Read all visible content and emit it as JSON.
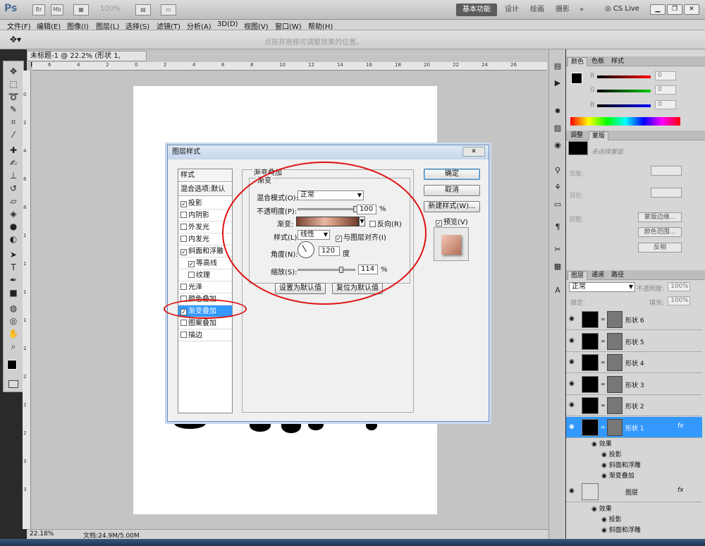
{
  "app": {
    "logo": "Ps",
    "zoom": "100%",
    "workspaces": [
      "基本功能",
      "设计",
      "绘画",
      "摄影"
    ],
    "more": "»",
    "cslive": "CS Live"
  },
  "menu": [
    "文件(F)",
    "编辑(E)",
    "图像(I)",
    "图层(L)",
    "选择(S)",
    "滤镜(T)",
    "分析(A)",
    "3D(D)",
    "视图(V)",
    "窗口(W)",
    "帮助(H)"
  ],
  "options_hint": "点按并拖移可调整效果的位置。",
  "doc": {
    "tab": "未标题-1 @ 22.2% (形状 1, RGB/8) *",
    "ruler_top": [
      "6",
      "4",
      "2",
      "0",
      "2",
      "4",
      "6",
      "8",
      "10",
      "12",
      "14",
      "16",
      "18",
      "20",
      "22",
      "24",
      "26"
    ],
    "ruler_left": [
      "0",
      "2",
      "4",
      "6",
      "8",
      "1",
      "1",
      "1",
      "1",
      "2",
      "2",
      "2",
      "2",
      "3",
      "3"
    ],
    "status_zoom": "22.18%",
    "status_doc": "文档:24.9M/5.00M"
  },
  "dialog": {
    "title": "图层样式",
    "close": "✕",
    "styles_header": "样式",
    "blend_default": "混合选项:默认",
    "items": [
      {
        "label": "投影",
        "checked": true,
        "sub": false,
        "selected": false
      },
      {
        "label": "内阴影",
        "checked": false,
        "sub": false,
        "selected": false
      },
      {
        "label": "外发光",
        "checked": false,
        "sub": false,
        "selected": false
      },
      {
        "label": "内发光",
        "checked": false,
        "sub": false,
        "selected": false
      },
      {
        "label": "斜面和浮雕",
        "checked": true,
        "sub": false,
        "selected": false
      },
      {
        "label": "等高线",
        "checked": true,
        "sub": true,
        "selected": false
      },
      {
        "label": "纹理",
        "checked": false,
        "sub": true,
        "selected": false
      },
      {
        "label": "光泽",
        "checked": false,
        "sub": false,
        "selected": false
      },
      {
        "label": "颜色叠加",
        "checked": false,
        "sub": false,
        "selected": false
      },
      {
        "label": "渐变叠加",
        "checked": true,
        "sub": false,
        "selected": true
      },
      {
        "label": "图案叠加",
        "checked": false,
        "sub": false,
        "selected": false
      },
      {
        "label": "描边",
        "checked": false,
        "sub": false,
        "selected": false
      }
    ],
    "section_title": "渐变叠加",
    "group_title": "渐变",
    "blend_mode_label": "混合模式(O):",
    "blend_mode_value": "正常",
    "opacity_label": "不透明度(P):",
    "opacity_value": "100",
    "opacity_unit": "%",
    "opacity_fraction": 1.0,
    "gradient_label": "渐变:",
    "reverse_label": "反向(R)",
    "style_label": "样式(L):",
    "style_value": "线性",
    "align_label": "与图层对齐(I)",
    "angle_label": "角度(N):",
    "angle_value": "120",
    "angle_unit": "度",
    "scale_label": "缩放(S):",
    "scale_value": "114",
    "scale_unit": "%",
    "scale_fraction": 0.76,
    "btn_set_default": "设置为默认值",
    "btn_reset_default": "复位为默认值",
    "btn_ok": "确定",
    "btn_cancel": "取消",
    "btn_new_style": "新建样式(W)...",
    "preview_label": "预览(V)",
    "preview_checked": true
  },
  "color_panel": {
    "tabs": [
      "颜色",
      "色板",
      "样式"
    ],
    "channels": [
      {
        "label": "R",
        "value": "0"
      },
      {
        "label": "G",
        "value": "0"
      },
      {
        "label": "B",
        "value": "0"
      }
    ]
  },
  "adjust_panel": {
    "tabs": [
      "调整",
      "蒙版"
    ],
    "no_mask": "未选择蒙版",
    "density_label": "浓度:",
    "feather_label": "羽化:",
    "refine_label": "调整:",
    "btn_mask_edge": "蒙版边缘...",
    "btn_color_range": "颜色范围...",
    "btn_invert": "反相"
  },
  "layers_panel": {
    "tabs": [
      "图层",
      "通道",
      "路径"
    ],
    "blend": "正常",
    "opacity_label": "不透明度:",
    "opacity_value": "100%",
    "lock_label": "锁定:",
    "fill_label": "填充:",
    "fill_value": "100%",
    "layers": [
      {
        "name": "形状 6",
        "selected": false
      },
      {
        "name": "形状 5",
        "selected": false
      },
      {
        "name": "形状 4",
        "selected": false
      },
      {
        "name": "形状 3",
        "selected": false
      },
      {
        "name": "形状 2",
        "selected": false
      },
      {
        "name": "形状 1",
        "selected": true
      }
    ],
    "fx": "fx",
    "effects_label": "效果",
    "effects": [
      "投影",
      "斜面和浮雕",
      "渐变叠加"
    ],
    "bottom_layer_name": "图层",
    "bottom_effects": [
      "效果",
      "投影",
      "斜面和浮雕"
    ]
  },
  "colors": {
    "accent": "#3399ff",
    "annotation": "#e01010"
  }
}
